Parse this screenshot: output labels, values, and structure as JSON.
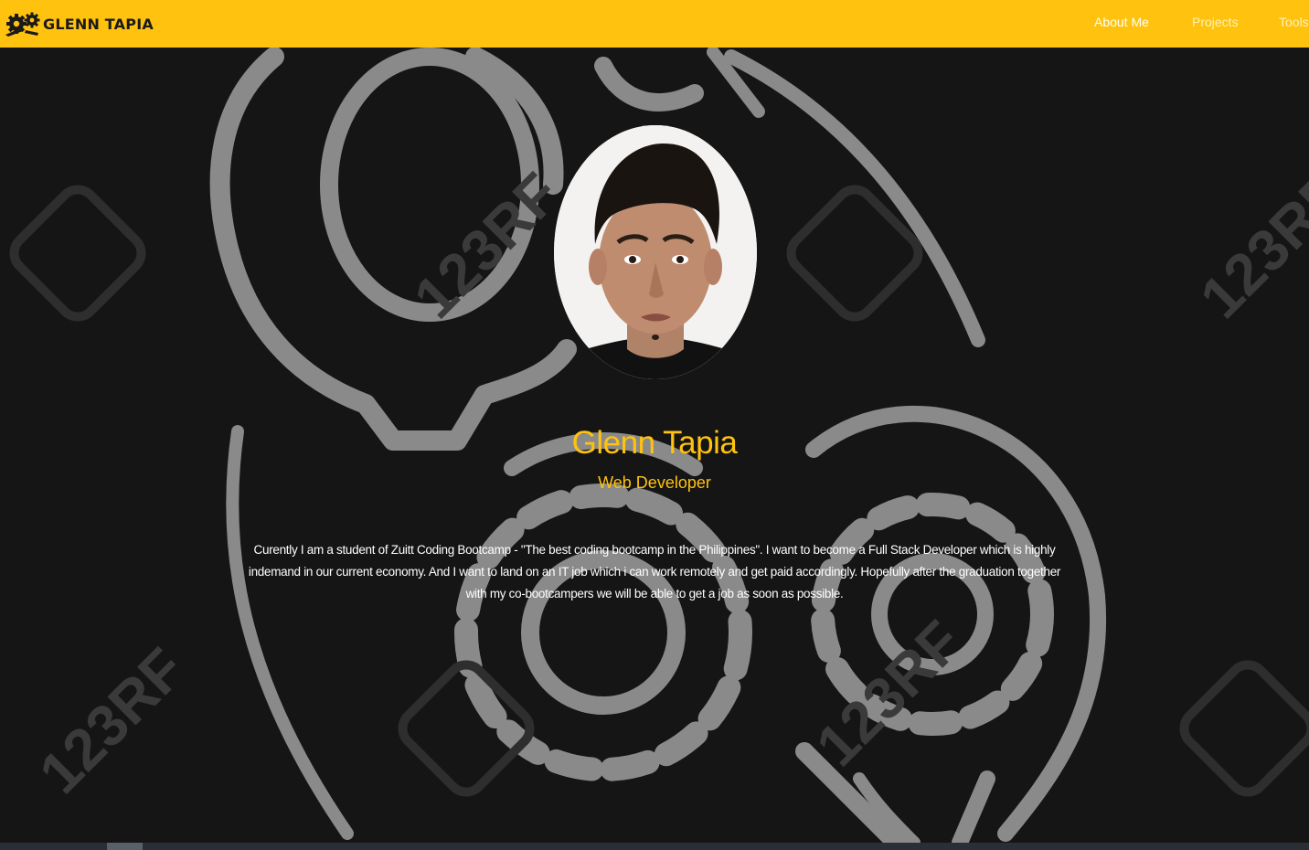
{
  "navbar": {
    "brand": "GLENN TAPIA",
    "links": [
      {
        "label": "About Me"
      },
      {
        "label": "Projects"
      },
      {
        "label": "Tools"
      }
    ]
  },
  "hero": {
    "name": "Glenn Tapia",
    "role": "Web Developer",
    "bio": "Curently I am a student of Zuitt Coding Bootcamp - \"The best coding bootcamp in the Philippines\". I want to become a Full Stack Developer which is highly indemand in our current economy. And I want to land on an IT job which i can work remotely and get paid accordingly. Hopefully after the graduation together with my co-bootcampers we will be able to get a job as soon as possible.",
    "watermark": "123RF"
  },
  "colors": {
    "accent": "#ffc20e",
    "background": "#151515",
    "art": "#8a8a8a"
  }
}
